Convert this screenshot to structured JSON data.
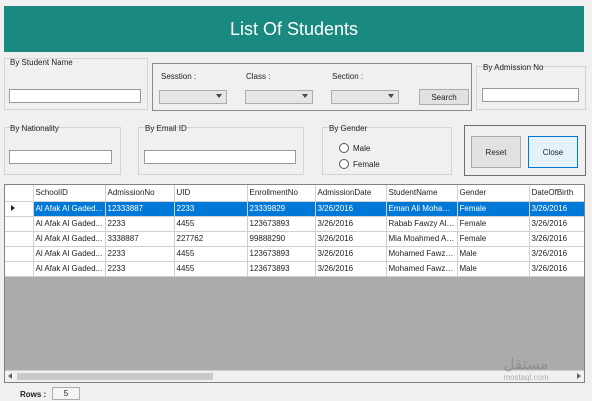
{
  "header": {
    "title": "List Of Students"
  },
  "filters": {
    "student_name_label": "By Student Name",
    "session_label": "Sesstion :",
    "class_label": "Class :",
    "section_label": "Section :",
    "search_label": "Search",
    "admission_no_label": "By Admission No",
    "nationality_label": "By Nationality",
    "email_label": "By Email ID",
    "gender_label": "By Gender",
    "gender_male": "Male",
    "gender_female": "Female",
    "reset_label": "Reset",
    "close_label": "Close"
  },
  "grid": {
    "columns": [
      "SchoolID",
      "AdmissionNo",
      "UID",
      "EnrollmentNo",
      "AdmissionDate",
      "StudentName",
      "Gender",
      "DateOfBirth"
    ],
    "rows": [
      [
        "Al Afak Al Gaded...",
        "12333887",
        "2233",
        "23339829",
        "3/26/2016",
        "Eman Ali Moham...",
        "Female",
        "3/26/2016"
      ],
      [
        "Al Afak Al Gaded...",
        "2233",
        "4455",
        "123673893",
        "3/26/2016",
        "Rabab Fawzy Ali...",
        "Female",
        "3/26/2016"
      ],
      [
        "Al Afak Al Gaded...",
        "3338887",
        "227762",
        "99888290",
        "3/26/2016",
        "Mia Moahmed Ali...",
        "Female",
        "3/26/2016"
      ],
      [
        "Al Afak Al Gaded...",
        "2233",
        "4455",
        "123673893",
        "3/26/2016",
        "Mohamed Fawzy...",
        "Male",
        "3/26/2016"
      ],
      [
        "Al Afak Al Gaded...",
        "2233",
        "4455",
        "123673893",
        "3/26/2016",
        "Mohamed Fawzy...",
        "Male",
        "3/26/2016"
      ]
    ],
    "selected_row": 0
  },
  "footer": {
    "rows_label": "Rows :",
    "rows_count": "5"
  },
  "watermark": {
    "arabic": "مستقل",
    "latin": "mostaql.com"
  },
  "colors": {
    "header_bg": "#1a8a80",
    "selection": "#0078d7",
    "grid_bg": "#ababab"
  }
}
